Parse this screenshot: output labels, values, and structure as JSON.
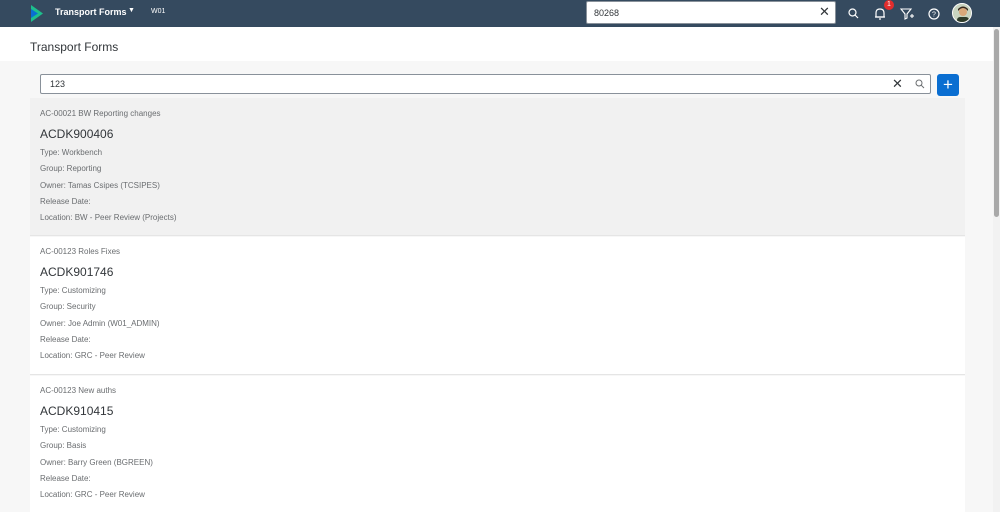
{
  "shell": {
    "app_title": "Transport Forms",
    "system_id": "W01",
    "search_value": "80268",
    "notification_count": "1",
    "colors": {
      "bar": "#354a5f",
      "accent": "#0a6ed1",
      "badge": "#e22d2d"
    }
  },
  "page": {
    "title": "Transport Forms"
  },
  "search": {
    "value": "123"
  },
  "list": {
    "items": [
      {
        "subtitle": "AC-00021 BW Reporting changes",
        "title": "ACDK900406",
        "type": "Type: Workbench",
        "group": "Group: Reporting",
        "owner": "Owner: Tamas Csipes (TCSIPES)",
        "release": "Release Date:",
        "location": "Location: BW - Peer Review (Projects)"
      },
      {
        "subtitle": "AC-00123 Roles Fixes",
        "title": "ACDK901746",
        "type": "Type: Customizing",
        "group": "Group: Security",
        "owner": "Owner: Joe Admin (W01_ADMIN)",
        "release": "Release Date:",
        "location": "Location: GRC - Peer Review"
      },
      {
        "subtitle": "AC-00123 New auths",
        "title": "ACDK910415",
        "type": "Type: Customizing",
        "group": "Group: Basis",
        "owner": "Owner: Barry Green (BGREEN)",
        "release": "Release Date:",
        "location": "Location: GRC - Peer Review"
      }
    ]
  }
}
